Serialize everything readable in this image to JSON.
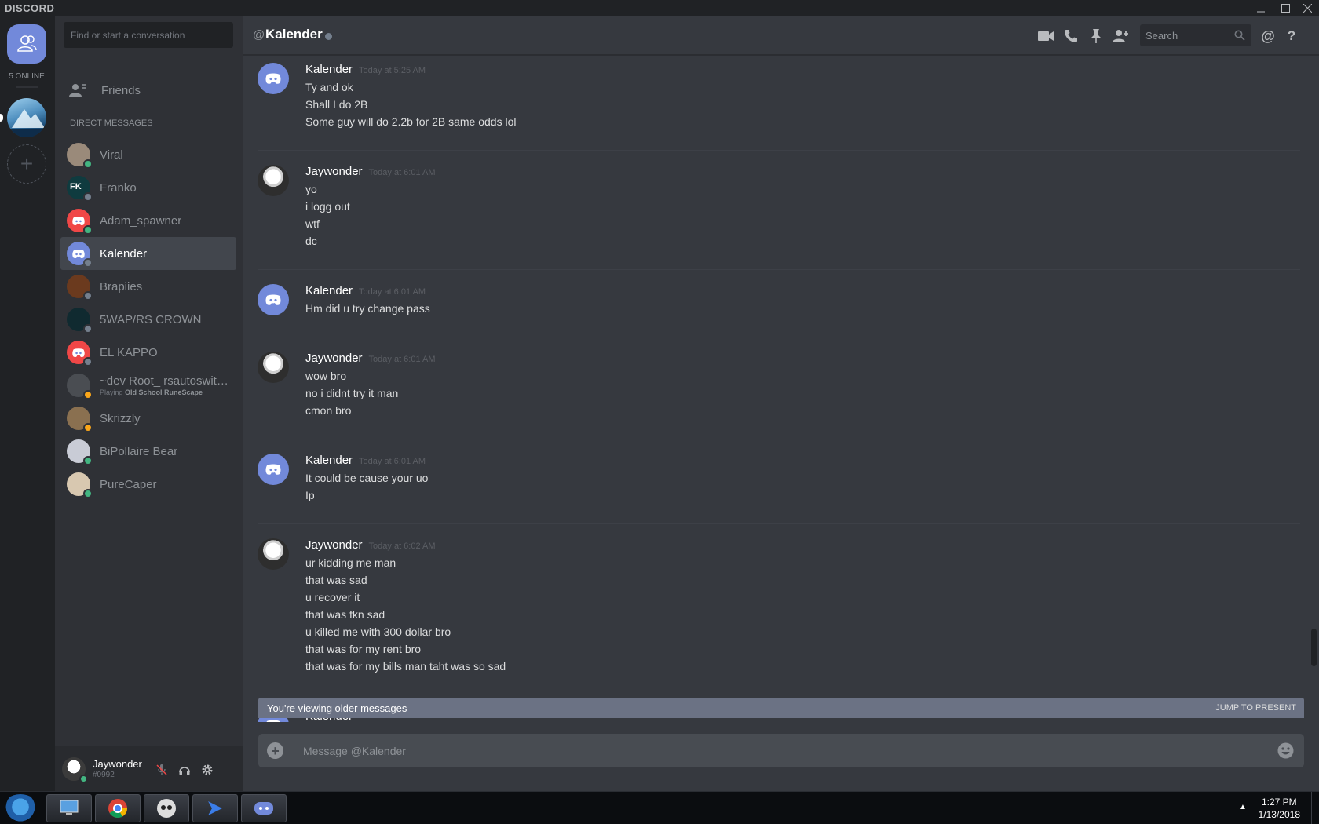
{
  "app": {
    "brand": "DISCORD"
  },
  "window": {
    "minimize_icon": "minimize-icon",
    "maximize_icon": "maximize-icon",
    "close_icon": "close-icon"
  },
  "guilds": {
    "online_text": "5 ONLINE",
    "home_icon": "friends-icon",
    "add_icon": "plus-icon"
  },
  "sidebar": {
    "search_placeholder": "Find or start a conversation",
    "friends_label": "Friends",
    "dm_header": "DIRECT MESSAGES",
    "dms": [
      {
        "name": "Viral",
        "status": "online",
        "avatar_color": "#9a8a7a"
      },
      {
        "name": "Franko",
        "status": "offline",
        "avatar_color": "#0f3b3f",
        "avatar_text": "FK"
      },
      {
        "name": "Adam_spawner",
        "status": "online",
        "avatar_color": "#f04747"
      },
      {
        "name": "Kalender",
        "status": "offline",
        "avatar_color": "#7289da",
        "active": true
      },
      {
        "name": "Brapiies",
        "status": "offline",
        "avatar_color": "#6b3a1e"
      },
      {
        "name": "5WAP/RS CROWN",
        "status": "offline",
        "avatar_color": "#102a30"
      },
      {
        "name": "EL KAPPO",
        "status": "offline",
        "avatar_color": "#f04747"
      },
      {
        "name": "~dev Root_ rsautoswitch...",
        "status": "idle",
        "avatar_color": "#4a4d52",
        "activity_prefix": "Playing",
        "activity": "Old School RuneScape"
      },
      {
        "name": "Skrizzly",
        "status": "idle",
        "avatar_color": "#8a7050"
      },
      {
        "name": "BiPollaire Bear",
        "status": "online",
        "avatar_color": "#c9ccd6"
      },
      {
        "name": "PureCaper",
        "status": "online",
        "avatar_color": "#d8c8b0"
      }
    ]
  },
  "user_panel": {
    "username": "Jaywonder",
    "tag": "#0992",
    "status": "online"
  },
  "chat": {
    "at_symbol": "@",
    "channel_name": "Kalender",
    "search_placeholder": "Search",
    "messages": [
      {
        "author": "Kalender",
        "time": "Today at 5:25 AM",
        "avatar": "kalender",
        "lines": [
          "Ty and ok",
          "Shall I do 2B",
          "Some guy will do 2.2b for 2B same odds lol"
        ]
      },
      {
        "author": "Jaywonder",
        "time": "Today at 6:01 AM",
        "avatar": "jaywonder",
        "lines": [
          "yo",
          "i logg out",
          "wtf",
          "dc"
        ]
      },
      {
        "author": "Kalender",
        "time": "Today at 6:01 AM",
        "avatar": "kalender",
        "lines": [
          "Hm did u try change pass"
        ]
      },
      {
        "author": "Jaywonder",
        "time": "Today at 6:01 AM",
        "avatar": "jaywonder",
        "lines": [
          "wow bro",
          "no i didnt try it man",
          "cmon bro"
        ]
      },
      {
        "author": "Kalender",
        "time": "Today at 6:01 AM",
        "avatar": "kalender",
        "lines": [
          "It could be cause your uo",
          "Ip"
        ]
      },
      {
        "author": "Jaywonder",
        "time": "Today at 6:02 AM",
        "avatar": "jaywonder",
        "lines": [
          "ur kidding me man",
          "that was sad",
          "u recover it",
          "that was fkn sad",
          "u killed me with 300 dollar bro",
          "that was for my rent bro",
          "that was for my bills man taht was so sad"
        ]
      }
    ],
    "partial_author": "Kalender",
    "older_notice": "You're viewing older messages",
    "jump_label": "JUMP TO PRESENT",
    "composer_placeholder": "Message @Kalender"
  },
  "taskbar": {
    "time": "1:27 PM",
    "date": "1/13/2018",
    "items": [
      "explorer",
      "chrome",
      "app",
      "vs-code",
      "discord"
    ]
  },
  "colors": {
    "accent": "#7289da",
    "online": "#43b581",
    "idle": "#faa61a",
    "offline": "#747f8d"
  }
}
